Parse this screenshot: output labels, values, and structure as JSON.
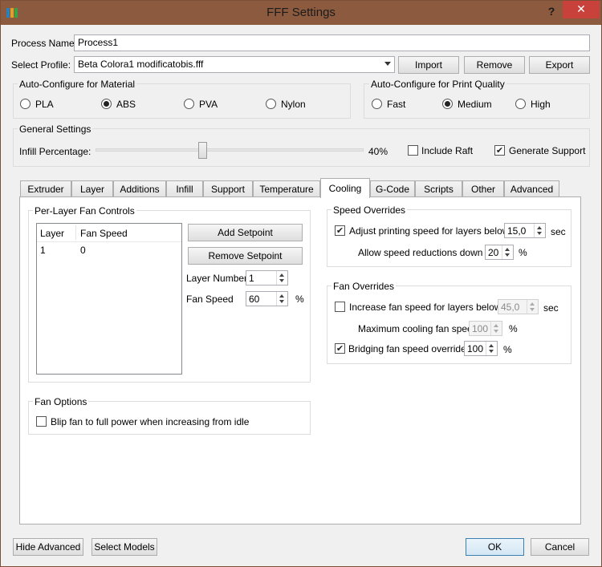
{
  "window": {
    "title": "FFF Settings",
    "help_glyph": "?",
    "close_glyph": "✕"
  },
  "process": {
    "name_label": "Process Name:",
    "name_value": "Process1"
  },
  "profile": {
    "label": "Select Profile:",
    "selected": "Beta Colora1 modificatobis.fff",
    "import": "Import",
    "remove": "Remove",
    "export": "Export"
  },
  "material": {
    "title": "Auto-Configure for Material",
    "options": [
      {
        "label": "PLA",
        "checked": false
      },
      {
        "label": "ABS",
        "checked": true
      },
      {
        "label": "PVA",
        "checked": false
      },
      {
        "label": "Nylon",
        "checked": false
      }
    ]
  },
  "quality": {
    "title": "Auto-Configure for Print Quality",
    "options": [
      {
        "label": "Fast",
        "checked": false
      },
      {
        "label": "Medium",
        "checked": true
      },
      {
        "label": "High",
        "checked": false
      }
    ]
  },
  "general": {
    "title": "General Settings",
    "infill_label": "Infill Percentage:",
    "infill_value": "40%",
    "infill_level": 0.4,
    "include_raft": "Include Raft",
    "include_raft_checked": false,
    "generate_support": "Generate Support",
    "generate_support_checked": true
  },
  "tabs": [
    {
      "label": "Extruder"
    },
    {
      "label": "Layer"
    },
    {
      "label": "Additions"
    },
    {
      "label": "Infill"
    },
    {
      "label": "Support"
    },
    {
      "label": "Temperature"
    },
    {
      "label": "Cooling",
      "active": true
    },
    {
      "label": "G-Code"
    },
    {
      "label": "Scripts"
    },
    {
      "label": "Other"
    },
    {
      "label": "Advanced"
    }
  ],
  "cooling": {
    "per_layer": {
      "title": "Per-Layer Fan Controls",
      "columns": [
        "Layer",
        "Fan Speed"
      ],
      "rows": [
        [
          "1",
          "0"
        ]
      ],
      "add_setpoint": "Add Setpoint",
      "remove_setpoint": "Remove Setpoint",
      "layer_number_label": "Layer Number",
      "layer_number_value": "1",
      "fan_speed_label": "Fan Speed",
      "fan_speed_value": "60",
      "fan_speed_unit": "%"
    },
    "fan_options": {
      "title": "Fan Options",
      "blip_label": "Blip fan to full power when increasing from idle",
      "blip_checked": false
    },
    "speed_overrides": {
      "title": "Speed Overrides",
      "adjust_label": "Adjust printing speed for layers below",
      "adjust_checked": true,
      "adjust_value": "15,0",
      "adjust_unit": "sec",
      "allow_label": "Allow speed reductions down to",
      "allow_value": "20",
      "allow_unit": "%"
    },
    "fan_overrides": {
      "title": "Fan Overrides",
      "increase_label": "Increase fan speed for layers below",
      "increase_checked": false,
      "increase_value": "45,0",
      "increase_unit": "sec",
      "max_label": "Maximum cooling fan speed",
      "max_value": "100",
      "max_unit": "%",
      "bridging_label": "Bridging fan speed override",
      "bridging_checked": true,
      "bridging_value": "100",
      "bridging_unit": "%"
    }
  },
  "footer": {
    "hide_advanced": "Hide Advanced",
    "select_models": "Select Models",
    "ok": "OK",
    "cancel": "Cancel"
  },
  "colors": {
    "titlebar": "#8c5a3e",
    "close": "#c8413a",
    "panel": "#f0f0f0"
  }
}
